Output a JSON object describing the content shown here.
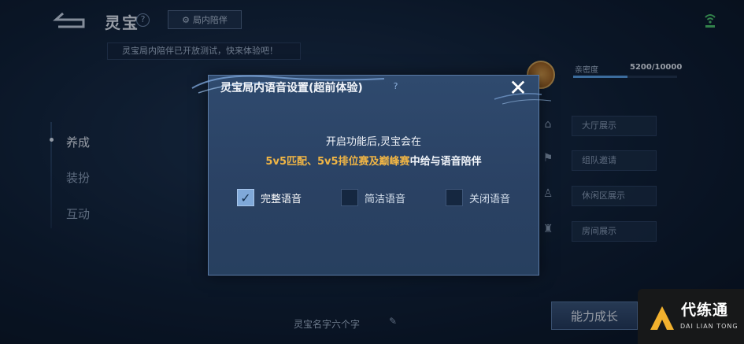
{
  "header": {
    "title": "灵宝",
    "help_glyph": "?",
    "companion_tab_label": "局内陪伴",
    "notice": "灵宝局内陪伴已开放测试，快来体验吧！"
  },
  "nav": {
    "items": [
      {
        "label": "养成",
        "active": true
      },
      {
        "label": "装扮",
        "active": false
      },
      {
        "label": "互动",
        "active": false
      }
    ]
  },
  "side_panel": {
    "intimacy_label": "亲密度",
    "intimacy_value": "5200/10000",
    "intimacy_progress": 0.52,
    "rows": [
      "大厅展示",
      "组队邀请",
      "休闲区展示",
      "房间展示"
    ]
  },
  "bottom": {
    "name": "灵宝名字六个字",
    "ability_button": "能力成长"
  },
  "modal": {
    "title": "灵宝局内语音设置(超前体验)",
    "help_glyph": "?",
    "close_glyph": "✕",
    "message_line1": "开启功能后,灵宝会在",
    "message_line2_highlight": "5v5匹配、5v5排位赛及巅峰赛",
    "message_line2_rest": "中给与语音陪伴",
    "options": [
      {
        "label": "完整语音",
        "checked": true
      },
      {
        "label": "简洁语音",
        "checked": false
      },
      {
        "label": "关闭语音",
        "checked": false
      }
    ]
  },
  "watermark": {
    "title": "代练通",
    "subtitle": "DAI LIAN TONG"
  },
  "colors": {
    "highlight": "#f0b545",
    "modal_bg": "#2f4a6e",
    "checkbox_checked": "#7fa8d9"
  }
}
